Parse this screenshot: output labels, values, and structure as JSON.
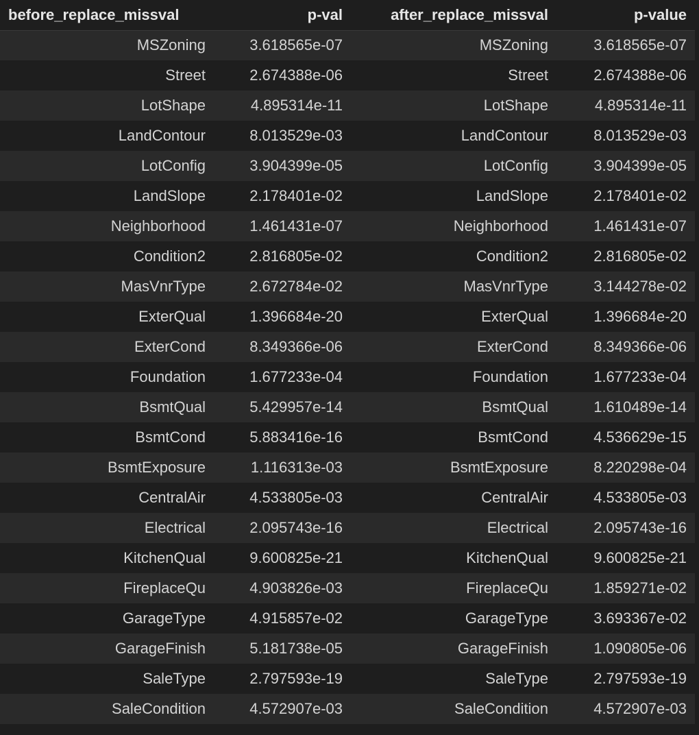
{
  "table": {
    "headers": [
      "before_replace_missval",
      "p-val",
      "after_replace_missval",
      "p-value"
    ],
    "rows": [
      [
        "MSZoning",
        "3.618565e-07",
        "MSZoning",
        "3.618565e-07"
      ],
      [
        "Street",
        "2.674388e-06",
        "Street",
        "2.674388e-06"
      ],
      [
        "LotShape",
        "4.895314e-11",
        "LotShape",
        "4.895314e-11"
      ],
      [
        "LandContour",
        "8.013529e-03",
        "LandContour",
        "8.013529e-03"
      ],
      [
        "LotConfig",
        "3.904399e-05",
        "LotConfig",
        "3.904399e-05"
      ],
      [
        "LandSlope",
        "2.178401e-02",
        "LandSlope",
        "2.178401e-02"
      ],
      [
        "Neighborhood",
        "1.461431e-07",
        "Neighborhood",
        "1.461431e-07"
      ],
      [
        "Condition2",
        "2.816805e-02",
        "Condition2",
        "2.816805e-02"
      ],
      [
        "MasVnrType",
        "2.672784e-02",
        "MasVnrType",
        "3.144278e-02"
      ],
      [
        "ExterQual",
        "1.396684e-20",
        "ExterQual",
        "1.396684e-20"
      ],
      [
        "ExterCond",
        "8.349366e-06",
        "ExterCond",
        "8.349366e-06"
      ],
      [
        "Foundation",
        "1.677233e-04",
        "Foundation",
        "1.677233e-04"
      ],
      [
        "BsmtQual",
        "5.429957e-14",
        "BsmtQual",
        "1.610489e-14"
      ],
      [
        "BsmtCond",
        "5.883416e-16",
        "BsmtCond",
        "4.536629e-15"
      ],
      [
        "BsmtExposure",
        "1.116313e-03",
        "BsmtExposure",
        "8.220298e-04"
      ],
      [
        "CentralAir",
        "4.533805e-03",
        "CentralAir",
        "4.533805e-03"
      ],
      [
        "Electrical",
        "2.095743e-16",
        "Electrical",
        "2.095743e-16"
      ],
      [
        "KitchenQual",
        "9.600825e-21",
        "KitchenQual",
        "9.600825e-21"
      ],
      [
        "FireplaceQu",
        "4.903826e-03",
        "FireplaceQu",
        "1.859271e-02"
      ],
      [
        "GarageType",
        "4.915857e-02",
        "GarageType",
        "3.693367e-02"
      ],
      [
        "GarageFinish",
        "5.181738e-05",
        "GarageFinish",
        "1.090805e-06"
      ],
      [
        "SaleType",
        "2.797593e-19",
        "SaleType",
        "2.797593e-19"
      ],
      [
        "SaleCondition",
        "4.572907e-03",
        "SaleCondition",
        "4.572907e-03"
      ]
    ]
  },
  "colors": {
    "background": "#1e1e1e",
    "row_stripe": "#2a2a2a",
    "text": "#d4d4d4",
    "header_text": "#e6e6e6"
  }
}
